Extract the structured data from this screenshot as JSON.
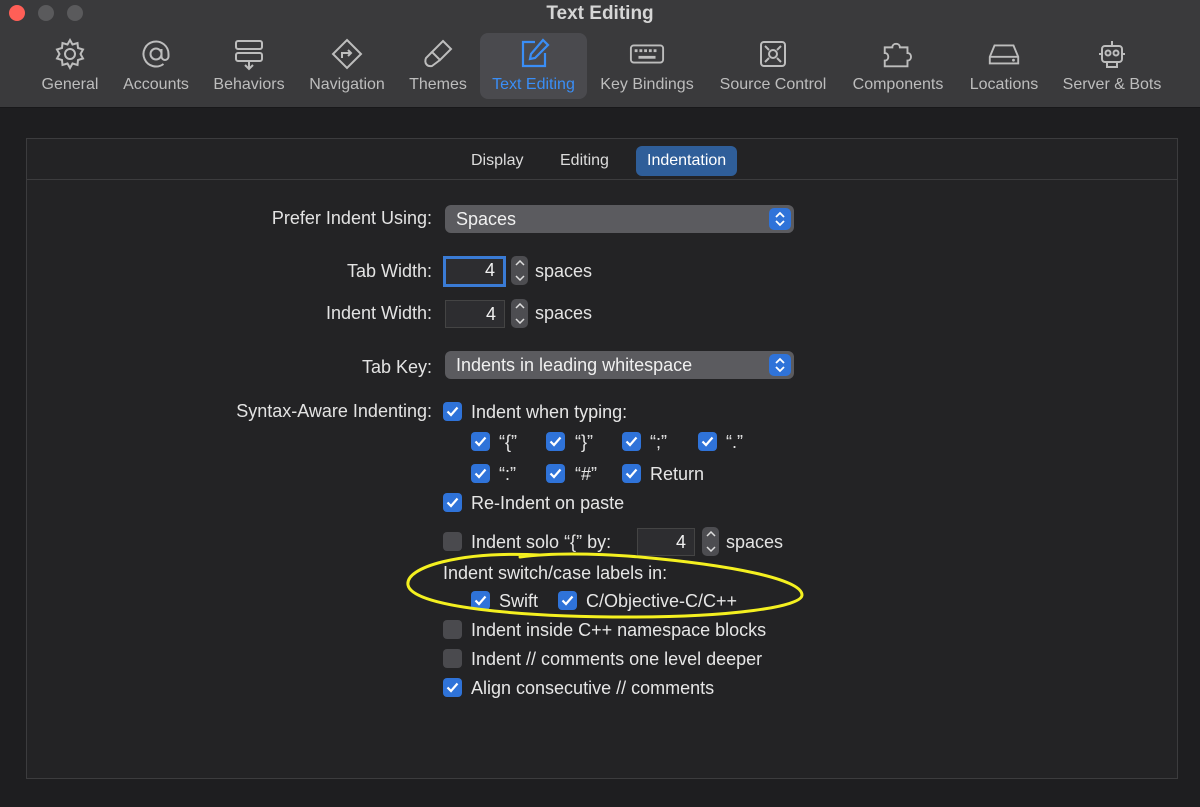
{
  "window": {
    "title": "Text Editing"
  },
  "toolbar": {
    "items": [
      {
        "label": "General",
        "icon": "gear-icon"
      },
      {
        "label": "Accounts",
        "icon": "at-icon"
      },
      {
        "label": "Behaviors",
        "icon": "behaviors-icon"
      },
      {
        "label": "Navigation",
        "icon": "navigation-icon"
      },
      {
        "label": "Themes",
        "icon": "brush-icon"
      },
      {
        "label": "Text Editing",
        "icon": "pencil-square-icon",
        "active": true
      },
      {
        "label": "Key Bindings",
        "icon": "keyboard-icon"
      },
      {
        "label": "Source Control",
        "icon": "source-control-icon"
      },
      {
        "label": "Components",
        "icon": "puzzle-icon"
      },
      {
        "label": "Locations",
        "icon": "drive-icon"
      },
      {
        "label": "Server & Bots",
        "icon": "robot-icon"
      }
    ],
    "active_color": "#3a8ef6"
  },
  "tabs": [
    {
      "label": "Display"
    },
    {
      "label": "Editing"
    },
    {
      "label": "Indentation",
      "active": true
    }
  ],
  "form": {
    "prefer_indent": {
      "label": "Prefer Indent Using:",
      "value": "Spaces"
    },
    "tab_width": {
      "label": "Tab Width:",
      "value": "4",
      "unit": "spaces"
    },
    "indent_width": {
      "label": "Indent Width:",
      "value": "4",
      "unit": "spaces"
    },
    "tab_key": {
      "label": "Tab Key:",
      "value": "Indents in leading whitespace"
    },
    "syntax_aware": {
      "label": "Syntax-Aware Indenting:",
      "indent_when_typing": {
        "label": "Indent when typing:",
        "checked": true
      },
      "chars_row1": [
        {
          "label": "“{”",
          "checked": true
        },
        {
          "label": "“}”",
          "checked": true
        },
        {
          "label": "“;”",
          "checked": true
        },
        {
          "label": "“.”",
          "checked": true
        }
      ],
      "chars_row2": [
        {
          "label": "“:”",
          "checked": true
        },
        {
          "label": "“#”",
          "checked": true
        },
        {
          "label": "Return",
          "checked": true
        }
      ],
      "reindent_paste": {
        "label": "Re-Indent on paste",
        "checked": true
      },
      "indent_solo": {
        "label": "Indent solo “{” by:",
        "checked": false,
        "value": "4",
        "unit": "spaces"
      },
      "switch_case_label": "Indent switch/case labels in:",
      "switch_swift": {
        "label": "Swift",
        "checked": true
      },
      "switch_c": {
        "label": "C/Objective-C/C++",
        "checked": true
      },
      "cpp_namespace": {
        "label": "Indent inside C++ namespace blocks",
        "checked": false
      },
      "comments_deeper": {
        "label": "Indent // comments one level deeper",
        "checked": false
      },
      "align_comments": {
        "label": "Align consecutive // comments",
        "checked": true
      }
    }
  },
  "annotation": {
    "shape": "ellipse",
    "color": "#f4f020"
  },
  "colors": {
    "accent": "#2f73d9",
    "background": "#1e1e20",
    "toolbar": "#3a3a3c"
  }
}
